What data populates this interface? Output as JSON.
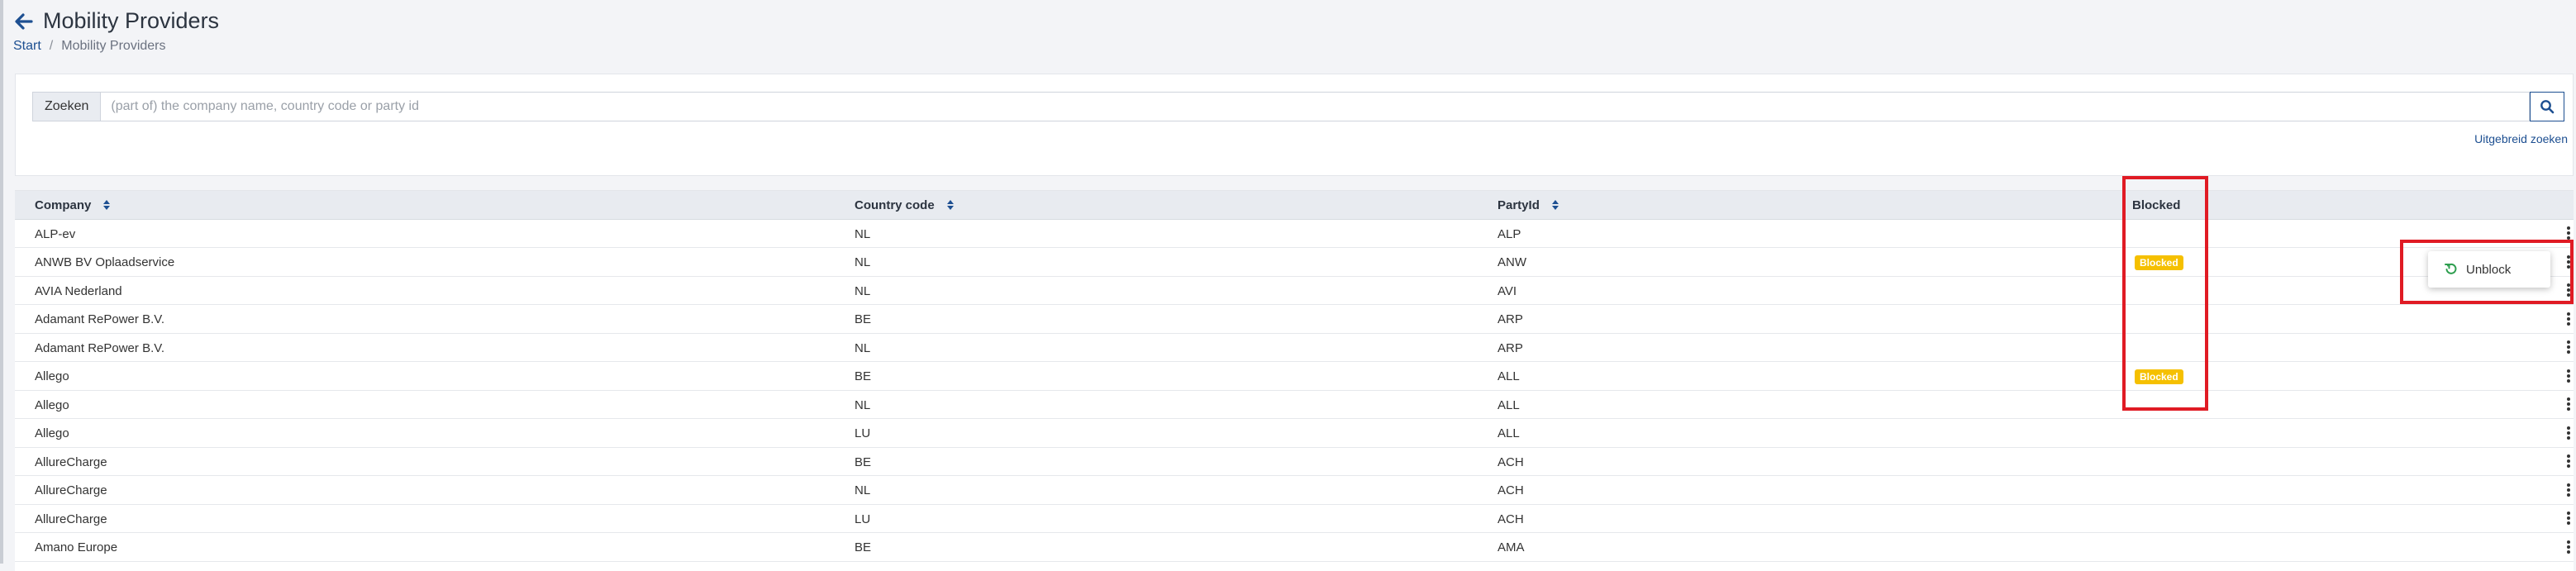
{
  "header": {
    "title": "Mobility Providers",
    "breadcrumb": {
      "home": "Start",
      "separator": "/",
      "current": "Mobility Providers"
    }
  },
  "search": {
    "prefix": "Zoeken",
    "placeholder": "(part of) the company name, country code or party id",
    "advanced_link": "Uitgebreid zoeken"
  },
  "table": {
    "columns": {
      "company": "Company",
      "country_code": "Country code",
      "party_id": "PartyId",
      "blocked": "Blocked"
    },
    "badge_label": "Blocked",
    "rows": [
      {
        "company": "ALP-ev",
        "country": "NL",
        "party": "ALP",
        "blocked": ""
      },
      {
        "company": "ANWB BV Oplaadservice",
        "country": "NL",
        "party": "ANW",
        "blocked": "Blocked"
      },
      {
        "company": "AVIA Nederland",
        "country": "NL",
        "party": "AVI",
        "blocked": ""
      },
      {
        "company": "Adamant RePower B.V.",
        "country": "BE",
        "party": "ARP",
        "blocked": ""
      },
      {
        "company": "Adamant RePower B.V.",
        "country": "NL",
        "party": "ARP",
        "blocked": ""
      },
      {
        "company": "Allego",
        "country": "BE",
        "party": "ALL",
        "blocked": "Blocked"
      },
      {
        "company": "Allego",
        "country": "NL",
        "party": "ALL",
        "blocked": ""
      },
      {
        "company": "Allego",
        "country": "LU",
        "party": "ALL",
        "blocked": ""
      },
      {
        "company": "AllureCharge",
        "country": "BE",
        "party": "ACH",
        "blocked": ""
      },
      {
        "company": "AllureCharge",
        "country": "NL",
        "party": "ACH",
        "blocked": ""
      },
      {
        "company": "AllureCharge",
        "country": "LU",
        "party": "ACH",
        "blocked": ""
      },
      {
        "company": "Amano Europe",
        "country": "BE",
        "party": "AMA",
        "blocked": ""
      }
    ]
  },
  "context_menu": {
    "unblock_label": "Unblock"
  },
  "colors": {
    "accent": "#1d4f91",
    "badge": "#f5c000",
    "highlight": "#e01b24",
    "unblock_icon": "#2e9e4f"
  },
  "icons": {
    "back": "arrow-left-icon",
    "search": "search-icon",
    "sort": "sort-icon",
    "row_menu": "kebab-menu-icon",
    "unblock": "undo-icon"
  }
}
